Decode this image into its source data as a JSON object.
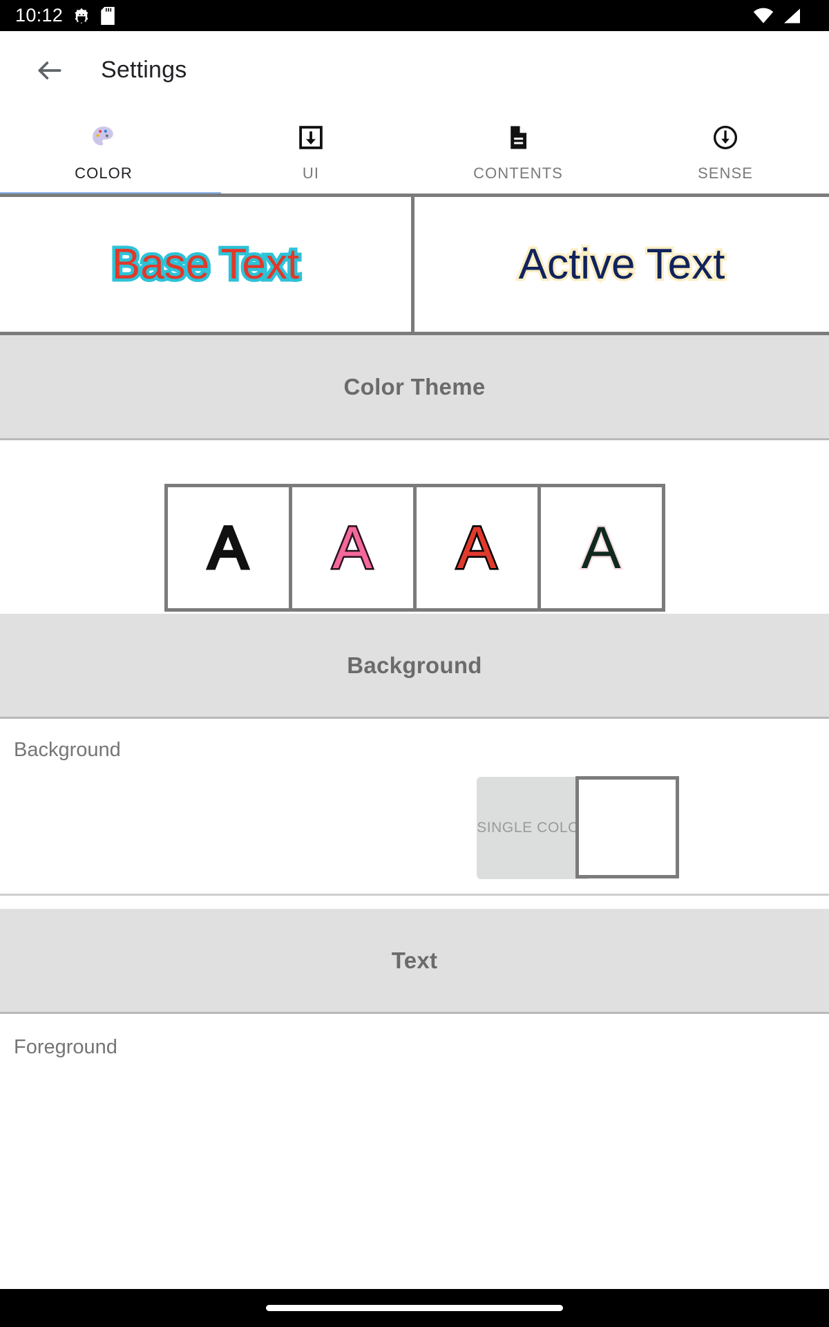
{
  "status_bar": {
    "clock": "10:12",
    "left_icons": [
      "android-settings-icon",
      "sd-card-icon"
    ],
    "right_icons": [
      "wifi-icon",
      "cell-signal-icon"
    ],
    "background": "#000000"
  },
  "app_bar": {
    "back_icon": "arrow-back-icon",
    "title": "Settings"
  },
  "tabs": {
    "active_index": 0,
    "indicator_color": "#8ab4e8",
    "items": [
      {
        "label": "COLOR",
        "icon": "palette-icon"
      },
      {
        "label": "UI",
        "icon": "download-box-icon"
      },
      {
        "label": "CONTENTS",
        "icon": "document-icon"
      },
      {
        "label": "SENSE",
        "icon": "circle-arrow-down-icon"
      }
    ]
  },
  "previews": [
    {
      "name": "base",
      "text": "Base Text",
      "fill": "#e0392a",
      "outline": "#2cc3d8"
    },
    {
      "name": "active",
      "text": "Active Text",
      "fill": "#10235c",
      "outline": "#fbeec4"
    }
  ],
  "sections": {
    "color_theme": {
      "title": "Color Theme",
      "swatches": [
        {
          "glyph": "A",
          "fill": "#111111",
          "outline": "#111111"
        },
        {
          "glyph": "A",
          "fill": "#f4689a",
          "outline": "#2a1020"
        },
        {
          "glyph": "A",
          "fill": "#e03a2e",
          "outline": "#000000"
        },
        {
          "glyph": "A",
          "fill": "#10291f",
          "outline": "#fadfe4"
        }
      ]
    },
    "background": {
      "title": "Background",
      "row_label": "Background",
      "single_color_label": "SINGLE COLOR",
      "chip_color": "#ffffff"
    },
    "text": {
      "title": "Text",
      "row_label": "Foreground"
    }
  },
  "nav_bar": {
    "handle": "home-gesture-pill"
  }
}
